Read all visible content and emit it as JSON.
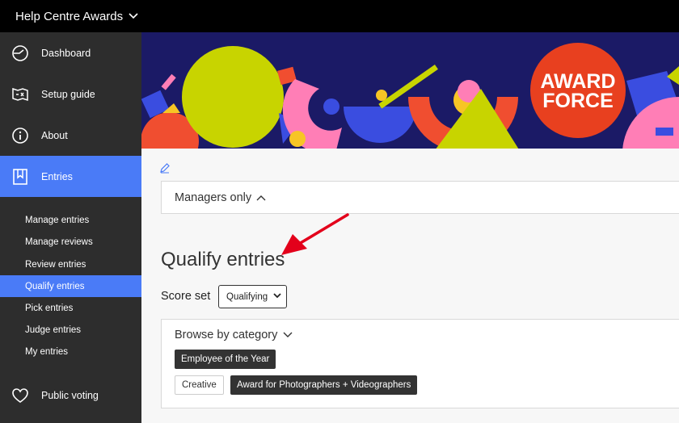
{
  "topbar": {
    "title": "Help Centre Awards",
    "chevron_icon": "chevron-down-icon"
  },
  "sidebar": {
    "items": [
      {
        "label": "Dashboard",
        "icon": "dashboard-gauge-icon"
      },
      {
        "label": "Setup guide",
        "icon": "map-guide-icon"
      },
      {
        "label": "About",
        "icon": "info-icon"
      },
      {
        "label": "Entries",
        "icon": "bookmark-icon",
        "active": true
      },
      {
        "label": "Public voting",
        "icon": "heart-icon"
      }
    ],
    "subitems": [
      {
        "label": "Manage entries"
      },
      {
        "label": "Manage reviews"
      },
      {
        "label": "Review entries"
      },
      {
        "label": "Qualify entries",
        "active": true
      },
      {
        "label": "Pick entries"
      },
      {
        "label": "Judge entries"
      },
      {
        "label": "My entries"
      }
    ]
  },
  "banner": {
    "logo_line1": "AWARD",
    "logo_line2": "FORCE"
  },
  "main": {
    "edit_icon": "pencil-icon",
    "managers_label": "Managers only",
    "title": "Qualify entries",
    "score_label": "Score set",
    "score_value": "Qualifying",
    "browse_label": "Browse by category",
    "tags_row1": [
      "Employee of the Year"
    ],
    "tags_row2": [
      "Creative",
      "Award for Photographers + Videographers"
    ]
  },
  "colors": {
    "accent": "#4a7bf7",
    "sidebar": "#2d2d2d",
    "banner": "#1b1a66",
    "arrow": "#e3001b"
  }
}
